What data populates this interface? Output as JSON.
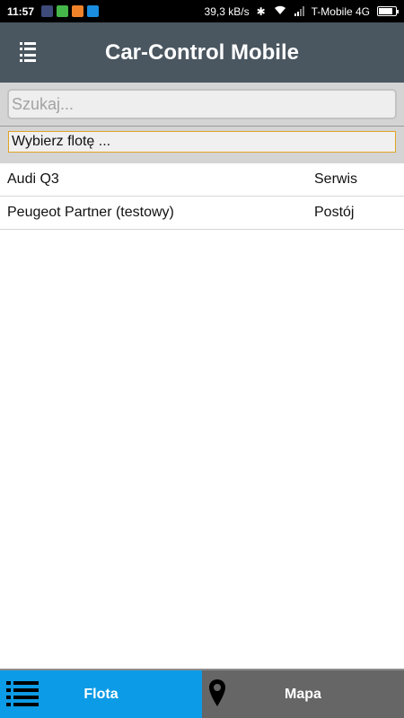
{
  "status_bar": {
    "time": "11:57",
    "network_speed": "39,3 kB/s",
    "carrier": "T-Mobile 4G",
    "battery_level": 0.85,
    "apps": [
      {
        "icon": "gallery-icon",
        "color": "#3d4a7a"
      },
      {
        "icon": "messenger-icon",
        "color": "#45b649"
      },
      {
        "icon": "orange-app-icon",
        "color": "#f0822a"
      },
      {
        "icon": "camera-app-icon",
        "color": "#1a8de0"
      }
    ]
  },
  "header": {
    "title": "Car-Control Mobile",
    "menu_icon": "list-menu-icon"
  },
  "search": {
    "placeholder": "Szukaj..."
  },
  "fleet": {
    "selected": "Wybierz flotę ..."
  },
  "vehicles": [
    {
      "name": "Audi Q3",
      "status": "Serwis"
    },
    {
      "name": "Peugeot Partner (testowy)",
      "status": "Postój"
    }
  ],
  "tabs": [
    {
      "label": "Flota",
      "icon": "list-icon",
      "active": true,
      "color": "#0c9be6"
    },
    {
      "label": "Mapa",
      "icon": "map-pin-icon",
      "active": false,
      "color": "#666666"
    }
  ]
}
